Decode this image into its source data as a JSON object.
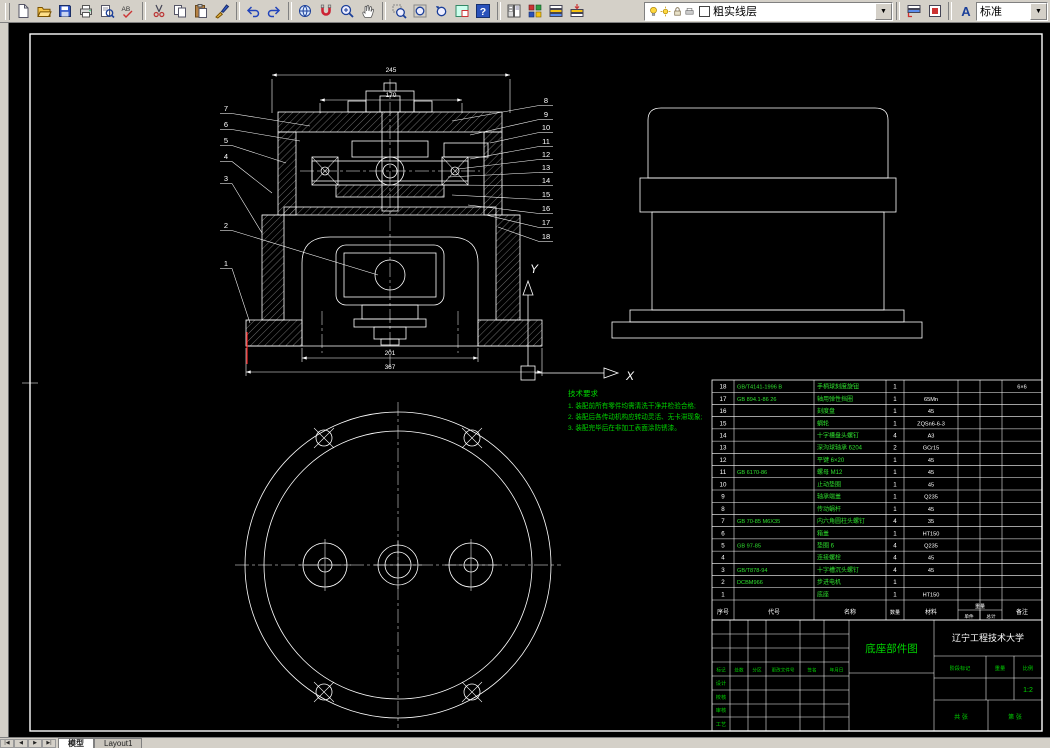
{
  "toolbar": {
    "groups": [
      [
        "new",
        "open",
        "save",
        "print",
        "print-preview",
        "spell"
      ],
      [
        "cut",
        "copy",
        "paste",
        "match-properties"
      ],
      [
        "undo",
        "redo"
      ],
      [
        "hyperlink",
        "osnap",
        "zoom-realtime",
        "pan"
      ],
      [
        "zoom-window",
        "zoom-all",
        "zoom-previous",
        "aerial-view",
        "help"
      ],
      [
        "designcenter",
        "properties",
        "layers",
        "make-layer-current"
      ]
    ],
    "right_groups": [
      [
        "layer-previous",
        "color-control"
      ],
      [
        "text-style"
      ]
    ],
    "layer_combo": {
      "value": "粗实线层"
    },
    "style_combo": {
      "value": "标准"
    }
  },
  "tab_bar": {
    "nav": [
      "|◀",
      "◀",
      "▶",
      "▶|"
    ],
    "tabs": [
      "模型",
      "Layout1"
    ]
  },
  "drawing": {
    "axis": {
      "x_label": "X",
      "y_label": "Y"
    },
    "tech_notes": {
      "title": "技术要求",
      "lines": [
        "1. 装配前所有零件均需清洗干净并检验合格;",
        "2. 装配后各传动机构应转动灵活、无卡滞现象;",
        "3. 装配完毕后在非加工表面涂防锈漆。"
      ]
    },
    "dimensions": {
      "d1": "245",
      "d2": "170",
      "d3": "201",
      "d4": "367"
    },
    "callouts_left": [
      "7",
      "6",
      "5",
      "4",
      "3",
      "2",
      "1"
    ],
    "callouts_right": [
      "8",
      "9",
      "10",
      "11",
      "12",
      "13",
      "14",
      "15",
      "16",
      "17",
      "18"
    ]
  },
  "bom": {
    "col_headers": {
      "no": "序号",
      "code": "代号",
      "name": "名称",
      "qty": "数量",
      "material": "材料",
      "weight": "重量",
      "unit": "单件",
      "total": "总计",
      "remark": "备注"
    },
    "rows": [
      [
        "18",
        "GB/T4141-1996 B",
        "手柄球刻度旋钮",
        "1",
        "",
        "6×6"
      ],
      [
        "17",
        "GB 894.1-86 26",
        "轴用弹性挡圈",
        "1",
        "65Mn",
        ""
      ],
      [
        "16",
        "",
        "刻度盘",
        "1",
        "45",
        ""
      ],
      [
        "15",
        "",
        "蜗轮",
        "1",
        "ZQSn6-6-3",
        ""
      ],
      [
        "14",
        "",
        "十字槽盘头螺钉",
        "4",
        "A3",
        ""
      ],
      [
        "13",
        "",
        "深沟球轴承 6204",
        "2",
        "GCr15",
        ""
      ],
      [
        "12",
        "",
        "平键 6×20",
        "1",
        "45",
        ""
      ],
      [
        "11",
        "GB 6170-86",
        "螺母 M12",
        "1",
        "45",
        ""
      ],
      [
        "10",
        "",
        "止动垫圈",
        "1",
        "45",
        ""
      ],
      [
        "9",
        "",
        "轴承端盖",
        "1",
        "Q235",
        ""
      ],
      [
        "8",
        "",
        "传动蜗杆",
        "1",
        "45",
        ""
      ],
      [
        "7",
        "GB 70-85 M6X35",
        "内六角圆柱头螺钉",
        "4",
        "35",
        ""
      ],
      [
        "6",
        "",
        "箱盖",
        "1",
        "HT150",
        ""
      ],
      [
        "5",
        "GB 97-85",
        "垫圈 6",
        "4",
        "Q235",
        ""
      ],
      [
        "4",
        "",
        "连接螺栓",
        "4",
        "45",
        ""
      ],
      [
        "3",
        "GB/T878-94",
        "十字槽沉头螺钉",
        "4",
        "45",
        ""
      ],
      [
        "2",
        "DCBM966",
        "步进电机",
        "1",
        "",
        ""
      ],
      [
        "1",
        "",
        "底座",
        "1",
        "HT150",
        ""
      ]
    ]
  },
  "title_block": {
    "drawing_name": "底座部件图",
    "university": "辽宁工程技术大学",
    "revision_headers": [
      "标记",
      "处数",
      "分区",
      "更改文件号",
      "签名",
      "年月日"
    ],
    "sign_labels": [
      "设计",
      "校核",
      "审核",
      "工艺"
    ],
    "stage_label": "阶段标记",
    "weight_label": "重量",
    "scale_label": "比例",
    "scale_value": "1:2",
    "sheet_total": "共 张",
    "sheet_no": "第 张"
  }
}
